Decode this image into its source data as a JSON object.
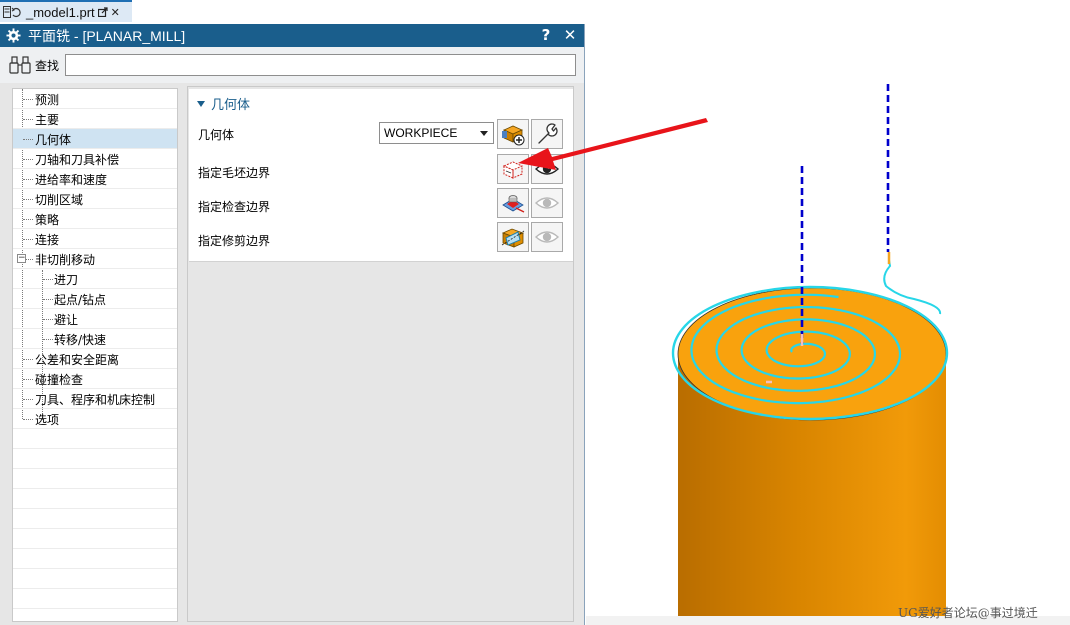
{
  "document_tab": {
    "filename": "_model1.prt",
    "close_glyph": "✕"
  },
  "dialog": {
    "title": "平面铣 - [PLANAR_MILL]",
    "help_glyph": "?",
    "close_glyph": "✕",
    "search": {
      "label": "查找",
      "value": ""
    }
  },
  "tree": {
    "items": [
      {
        "label": "预测"
      },
      {
        "label": "主要"
      },
      {
        "label": "几何体"
      },
      {
        "label": "刀轴和刀具补偿"
      },
      {
        "label": "进给率和速度"
      },
      {
        "label": "切削区域"
      },
      {
        "label": "策略"
      },
      {
        "label": "连接"
      },
      {
        "label": "非切削移动",
        "expander": "−"
      },
      {
        "label": "进刀"
      },
      {
        "label": "起点/钻点"
      },
      {
        "label": "避让"
      },
      {
        "label": "转移/快速"
      },
      {
        "label": "公差和安全距离"
      },
      {
        "label": "碰撞检查"
      },
      {
        "label": "刀具、程序和机床控制"
      },
      {
        "label": "选项"
      }
    ],
    "selected": "几何体"
  },
  "geometry_group": {
    "title": "几何体",
    "geometry_label": "几何体",
    "geometry_value": "WORKPIECE",
    "blank_boundary_label": "指定毛坯边界",
    "check_boundary_label": "指定检查边界",
    "trim_boundary_label": "指定修剪边界"
  },
  "viewport": {
    "watermark": "UG爱好者论坛@事过境迁",
    "colors": {
      "part_top": "#f9a20d",
      "part_side_dark": "#b96d00",
      "part_side_light": "#f19a09",
      "toolpath": "#27d6e8",
      "tool_axis": "#0000cc"
    }
  },
  "colors": {
    "titlebar": "#1a5e8c",
    "selection": "#cfe3f2",
    "annotation_arrow": "#e8141a"
  }
}
